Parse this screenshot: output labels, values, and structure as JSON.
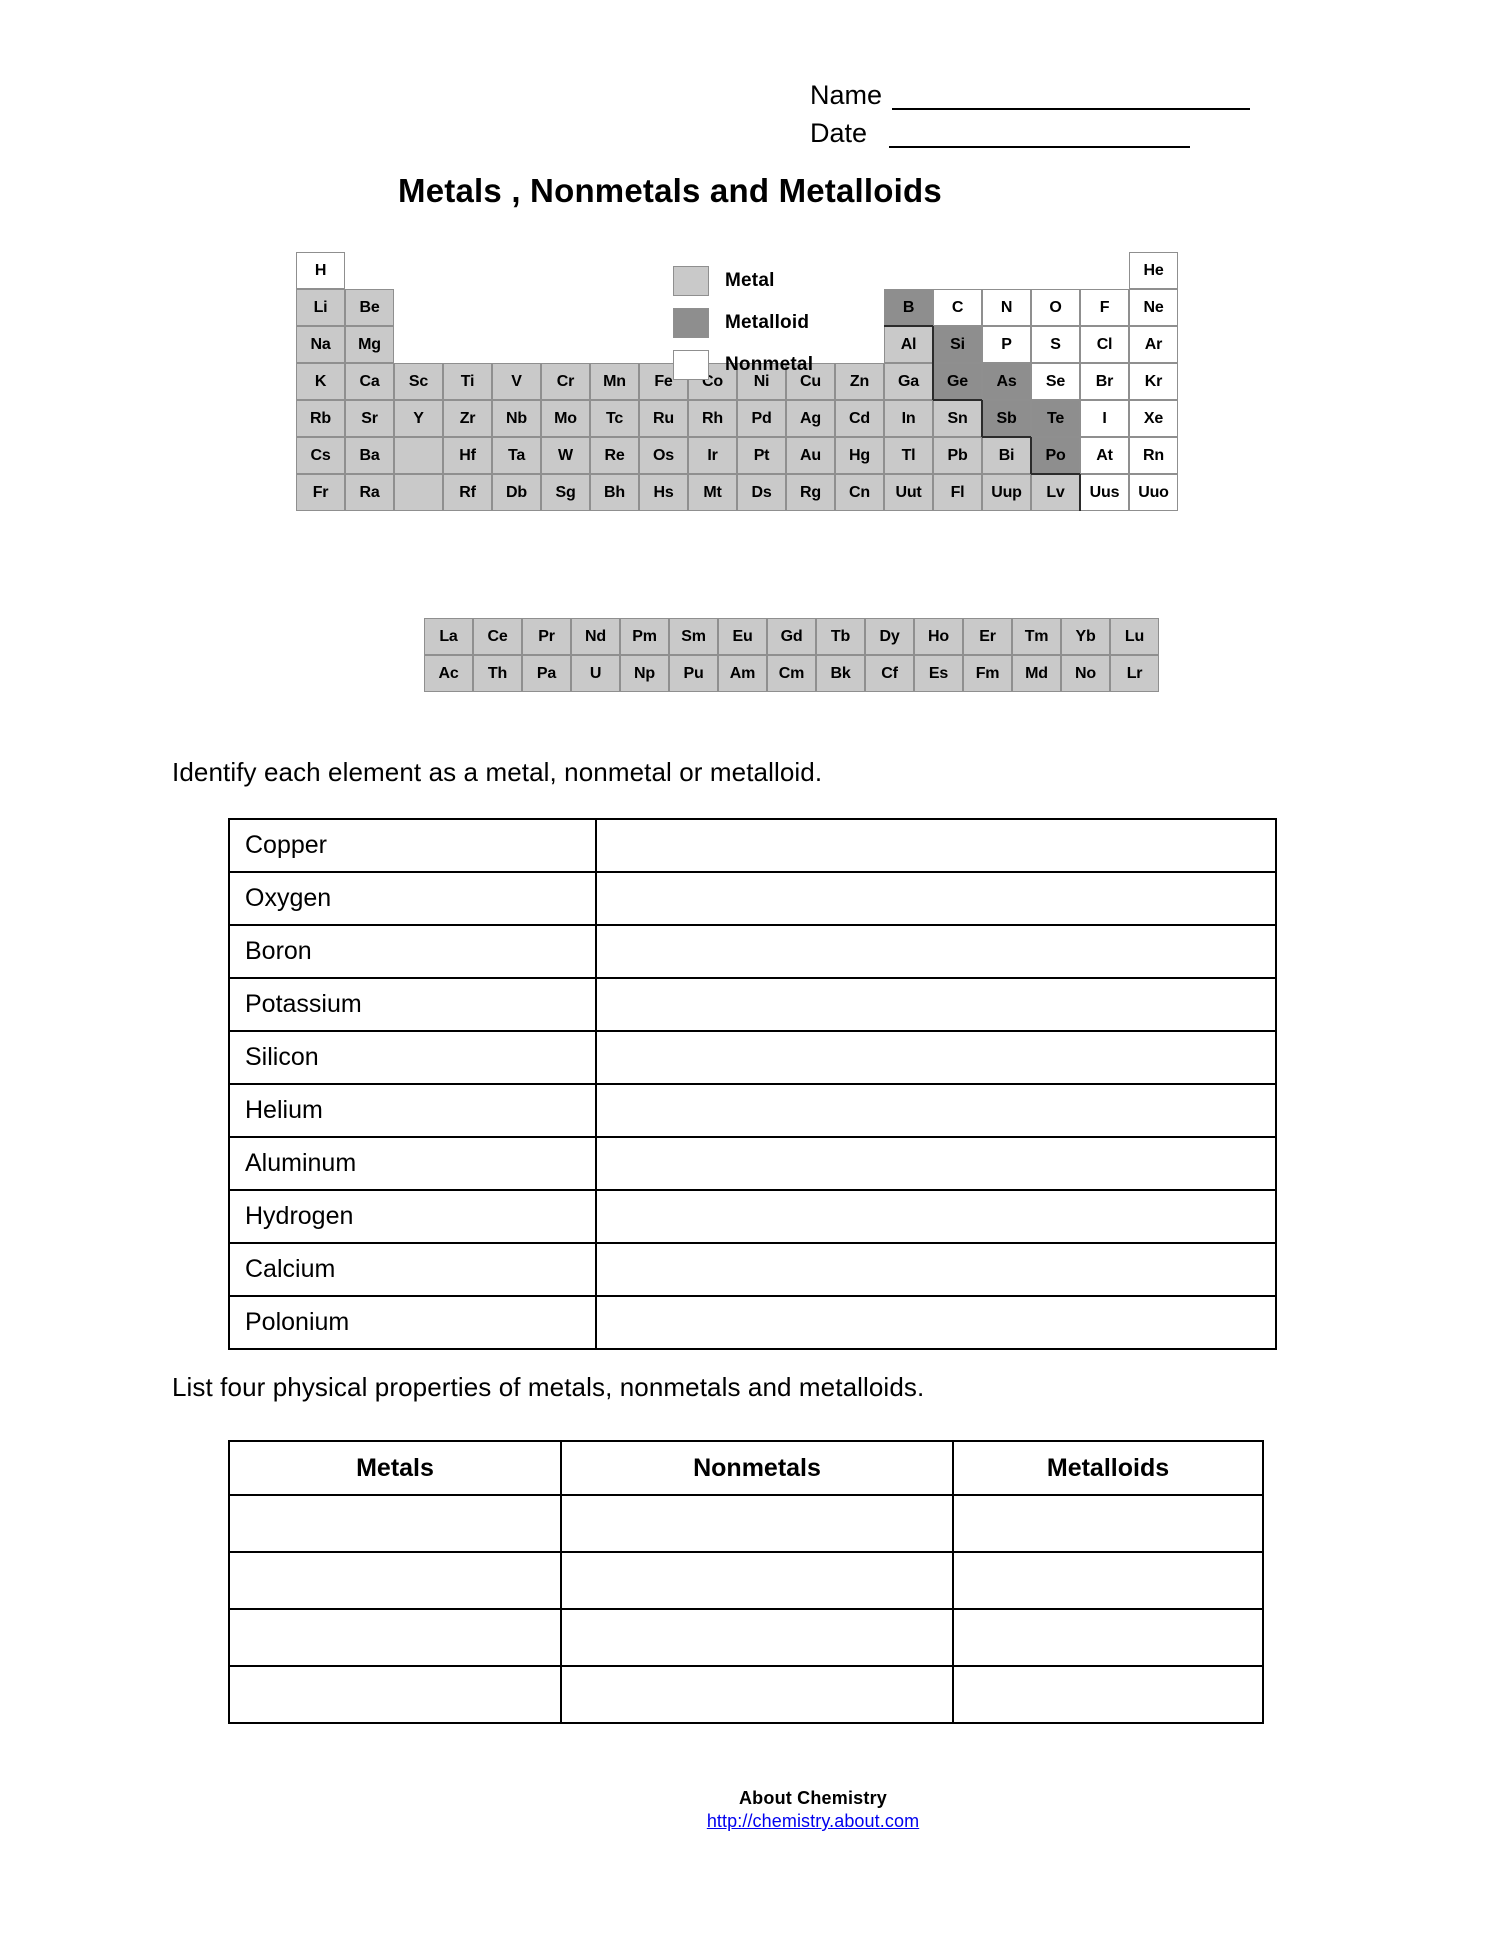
{
  "header": {
    "name_label": "Name",
    "date_label": "Date"
  },
  "title": "Metals , Nonmetals and Metalloids",
  "legend": {
    "items": [
      {
        "label": "Metal",
        "kind": "metal",
        "color": "#c9c9c9"
      },
      {
        "label": "Metalloid",
        "kind": "metalloid",
        "color": "#8e8e8e"
      },
      {
        "label": "Nonmetal",
        "kind": "nonmetal",
        "color": "#ffffff"
      }
    ]
  },
  "periodic_table": {
    "main_rows": [
      [
        {
          "symbol": "H",
          "kind": "nonmetal",
          "group": 1
        },
        {
          "symbol": "He",
          "kind": "nonmetal",
          "group": 18
        }
      ],
      [
        {
          "symbol": "Li",
          "kind": "metal",
          "group": 1
        },
        {
          "symbol": "Be",
          "kind": "metal",
          "group": 2
        },
        {
          "symbol": "B",
          "kind": "metalloid",
          "group": 13
        },
        {
          "symbol": "C",
          "kind": "nonmetal",
          "group": 14
        },
        {
          "symbol": "N",
          "kind": "nonmetal",
          "group": 15
        },
        {
          "symbol": "O",
          "kind": "nonmetal",
          "group": 16
        },
        {
          "symbol": "F",
          "kind": "nonmetal",
          "group": 17
        },
        {
          "symbol": "Ne",
          "kind": "nonmetal",
          "group": 18
        }
      ],
      [
        {
          "symbol": "Na",
          "kind": "metal",
          "group": 1
        },
        {
          "symbol": "Mg",
          "kind": "metal",
          "group": 2
        },
        {
          "symbol": "Al",
          "kind": "metal",
          "group": 13
        },
        {
          "symbol": "Si",
          "kind": "metalloid",
          "group": 14
        },
        {
          "symbol": "P",
          "kind": "nonmetal",
          "group": 15
        },
        {
          "symbol": "S",
          "kind": "nonmetal",
          "group": 16
        },
        {
          "symbol": "Cl",
          "kind": "nonmetal",
          "group": 17
        },
        {
          "symbol": "Ar",
          "kind": "nonmetal",
          "group": 18
        }
      ],
      [
        {
          "symbol": "K",
          "kind": "metal",
          "group": 1
        },
        {
          "symbol": "Ca",
          "kind": "metal",
          "group": 2
        },
        {
          "symbol": "Sc",
          "kind": "metal",
          "group": 3
        },
        {
          "symbol": "Ti",
          "kind": "metal",
          "group": 4
        },
        {
          "symbol": "V",
          "kind": "metal",
          "group": 5
        },
        {
          "symbol": "Cr",
          "kind": "metal",
          "group": 6
        },
        {
          "symbol": "Mn",
          "kind": "metal",
          "group": 7
        },
        {
          "symbol": "Fe",
          "kind": "metal",
          "group": 8
        },
        {
          "symbol": "Co",
          "kind": "metal",
          "group": 9
        },
        {
          "symbol": "Ni",
          "kind": "metal",
          "group": 10
        },
        {
          "symbol": "Cu",
          "kind": "metal",
          "group": 11
        },
        {
          "symbol": "Zn",
          "kind": "metal",
          "group": 12
        },
        {
          "symbol": "Ga",
          "kind": "metal",
          "group": 13
        },
        {
          "symbol": "Ge",
          "kind": "metalloid",
          "group": 14
        },
        {
          "symbol": "As",
          "kind": "metalloid",
          "group": 15
        },
        {
          "symbol": "Se",
          "kind": "nonmetal",
          "group": 16
        },
        {
          "symbol": "Br",
          "kind": "nonmetal",
          "group": 17
        },
        {
          "symbol": "Kr",
          "kind": "nonmetal",
          "group": 18
        }
      ],
      [
        {
          "symbol": "Rb",
          "kind": "metal",
          "group": 1
        },
        {
          "symbol": "Sr",
          "kind": "metal",
          "group": 2
        },
        {
          "symbol": "Y",
          "kind": "metal",
          "group": 3
        },
        {
          "symbol": "Zr",
          "kind": "metal",
          "group": 4
        },
        {
          "symbol": "Nb",
          "kind": "metal",
          "group": 5
        },
        {
          "symbol": "Mo",
          "kind": "metal",
          "group": 6
        },
        {
          "symbol": "Tc",
          "kind": "metal",
          "group": 7
        },
        {
          "symbol": "Ru",
          "kind": "metal",
          "group": 8
        },
        {
          "symbol": "Rh",
          "kind": "metal",
          "group": 9
        },
        {
          "symbol": "Pd",
          "kind": "metal",
          "group": 10
        },
        {
          "symbol": "Ag",
          "kind": "metal",
          "group": 11
        },
        {
          "symbol": "Cd",
          "kind": "metal",
          "group": 12
        },
        {
          "symbol": "In",
          "kind": "metal",
          "group": 13
        },
        {
          "symbol": "Sn",
          "kind": "metal",
          "group": 14
        },
        {
          "symbol": "Sb",
          "kind": "metalloid",
          "group": 15
        },
        {
          "symbol": "Te",
          "kind": "metalloid",
          "group": 16
        },
        {
          "symbol": "I",
          "kind": "nonmetal",
          "group": 17
        },
        {
          "symbol": "Xe",
          "kind": "nonmetal",
          "group": 18
        }
      ],
      [
        {
          "symbol": "Cs",
          "kind": "metal",
          "group": 1
        },
        {
          "symbol": "Ba",
          "kind": "metal",
          "group": 2
        },
        {
          "symbol": "",
          "kind": "blank",
          "group": 3
        },
        {
          "symbol": "Hf",
          "kind": "metal",
          "group": 4
        },
        {
          "symbol": "Ta",
          "kind": "metal",
          "group": 5
        },
        {
          "symbol": "W",
          "kind": "metal",
          "group": 6
        },
        {
          "symbol": "Re",
          "kind": "metal",
          "group": 7
        },
        {
          "symbol": "Os",
          "kind": "metal",
          "group": 8
        },
        {
          "symbol": "Ir",
          "kind": "metal",
          "group": 9
        },
        {
          "symbol": "Pt",
          "kind": "metal",
          "group": 10
        },
        {
          "symbol": "Au",
          "kind": "metal",
          "group": 11
        },
        {
          "symbol": "Hg",
          "kind": "metal",
          "group": 12
        },
        {
          "symbol": "Tl",
          "kind": "metal",
          "group": 13
        },
        {
          "symbol": "Pb",
          "kind": "metal",
          "group": 14
        },
        {
          "symbol": "Bi",
          "kind": "metal",
          "group": 15
        },
        {
          "symbol": "Po",
          "kind": "metalloid",
          "group": 16
        },
        {
          "symbol": "At",
          "kind": "nonmetal",
          "group": 17
        },
        {
          "symbol": "Rn",
          "kind": "nonmetal",
          "group": 18
        }
      ],
      [
        {
          "symbol": "Fr",
          "kind": "metal",
          "group": 1
        },
        {
          "symbol": "Ra",
          "kind": "metal",
          "group": 2
        },
        {
          "symbol": "",
          "kind": "blank",
          "group": 3
        },
        {
          "symbol": "Rf",
          "kind": "metal",
          "group": 4
        },
        {
          "symbol": "Db",
          "kind": "metal",
          "group": 5
        },
        {
          "symbol": "Sg",
          "kind": "metal",
          "group": 6
        },
        {
          "symbol": "Bh",
          "kind": "metal",
          "group": 7
        },
        {
          "symbol": "Hs",
          "kind": "metal",
          "group": 8
        },
        {
          "symbol": "Mt",
          "kind": "metal",
          "group": 9
        },
        {
          "symbol": "Ds",
          "kind": "metal",
          "group": 10
        },
        {
          "symbol": "Rg",
          "kind": "metal",
          "group": 11
        },
        {
          "symbol": "Cn",
          "kind": "metal",
          "group": 12
        },
        {
          "symbol": "Uut",
          "kind": "metal",
          "group": 13
        },
        {
          "symbol": "Fl",
          "kind": "metal",
          "group": 14
        },
        {
          "symbol": "Uup",
          "kind": "metal",
          "group": 15
        },
        {
          "symbol": "Lv",
          "kind": "metal",
          "group": 16
        },
        {
          "symbol": "Uus",
          "kind": "nonmetal",
          "group": 17
        },
        {
          "symbol": "Uuo",
          "kind": "nonmetal",
          "group": 18
        }
      ]
    ],
    "lanthanides": [
      {
        "symbol": "La",
        "kind": "metal"
      },
      {
        "symbol": "Ce",
        "kind": "metal"
      },
      {
        "symbol": "Pr",
        "kind": "metal"
      },
      {
        "symbol": "Nd",
        "kind": "metal"
      },
      {
        "symbol": "Pm",
        "kind": "metal"
      },
      {
        "symbol": "Sm",
        "kind": "metal"
      },
      {
        "symbol": "Eu",
        "kind": "metal"
      },
      {
        "symbol": "Gd",
        "kind": "metal"
      },
      {
        "symbol": "Tb",
        "kind": "metal"
      },
      {
        "symbol": "Dy",
        "kind": "metal"
      },
      {
        "symbol": "Ho",
        "kind": "metal"
      },
      {
        "symbol": "Er",
        "kind": "metal"
      },
      {
        "symbol": "Tm",
        "kind": "metal"
      },
      {
        "symbol": "Yb",
        "kind": "metal"
      },
      {
        "symbol": "Lu",
        "kind": "metal"
      }
    ],
    "actinides": [
      {
        "symbol": "Ac",
        "kind": "metal"
      },
      {
        "symbol": "Th",
        "kind": "metal"
      },
      {
        "symbol": "Pa",
        "kind": "metal"
      },
      {
        "symbol": "U",
        "kind": "metal"
      },
      {
        "symbol": "Np",
        "kind": "metal"
      },
      {
        "symbol": "Pu",
        "kind": "metal"
      },
      {
        "symbol": "Am",
        "kind": "metal"
      },
      {
        "symbol": "Cm",
        "kind": "metal"
      },
      {
        "symbol": "Bk",
        "kind": "metal"
      },
      {
        "symbol": "Cf",
        "kind": "metal"
      },
      {
        "symbol": "Es",
        "kind": "metal"
      },
      {
        "symbol": "Fm",
        "kind": "metal"
      },
      {
        "symbol": "Md",
        "kind": "metal"
      },
      {
        "symbol": "No",
        "kind": "metal"
      },
      {
        "symbol": "Lr",
        "kind": "metal"
      }
    ]
  },
  "question_1": {
    "instruction": "Identify each element as a metal, nonmetal or metalloid.",
    "rows": [
      {
        "element": "Copper",
        "answer": ""
      },
      {
        "element": "Oxygen",
        "answer": ""
      },
      {
        "element": "Boron",
        "answer": ""
      },
      {
        "element": "Potassium",
        "answer": ""
      },
      {
        "element": "Silicon",
        "answer": ""
      },
      {
        "element": "Helium",
        "answer": ""
      },
      {
        "element": "Aluminum",
        "answer": ""
      },
      {
        "element": "Hydrogen",
        "answer": ""
      },
      {
        "element": "Calcium",
        "answer": ""
      },
      {
        "element": "Polonium",
        "answer": ""
      }
    ]
  },
  "question_2": {
    "instruction": "List four physical properties of metals, nonmetals and metalloids.",
    "columns": [
      "Metals",
      "Nonmetals",
      "Metalloids"
    ],
    "rows": [
      [
        "",
        "",
        ""
      ],
      [
        "",
        "",
        ""
      ],
      [
        "",
        "",
        ""
      ],
      [
        "",
        "",
        ""
      ]
    ]
  },
  "footer": {
    "name": "About Chemistry",
    "url": "http://chemistry.about.com",
    "link_color": "#0000ee"
  }
}
